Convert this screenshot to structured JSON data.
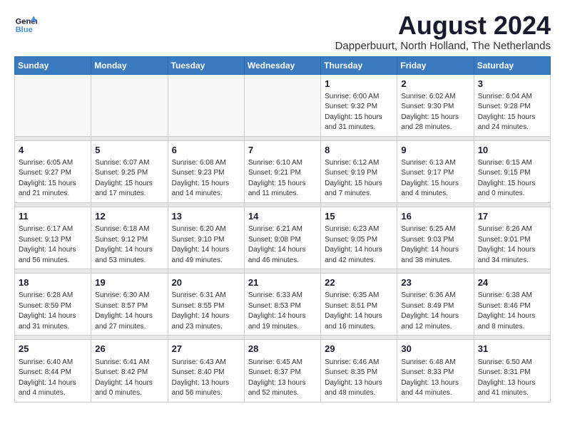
{
  "logo": {
    "line1": "General",
    "line2": "Blue"
  },
  "title": "August 2024",
  "subtitle": "Dapperbuurt, North Holland, The Netherlands",
  "days_of_week": [
    "Sunday",
    "Monday",
    "Tuesday",
    "Wednesday",
    "Thursday",
    "Friday",
    "Saturday"
  ],
  "weeks": [
    [
      {
        "day": "",
        "info": ""
      },
      {
        "day": "",
        "info": ""
      },
      {
        "day": "",
        "info": ""
      },
      {
        "day": "",
        "info": ""
      },
      {
        "day": "1",
        "info": "Sunrise: 6:00 AM\nSunset: 9:32 PM\nDaylight: 15 hours\nand 31 minutes."
      },
      {
        "day": "2",
        "info": "Sunrise: 6:02 AM\nSunset: 9:30 PM\nDaylight: 15 hours\nand 28 minutes."
      },
      {
        "day": "3",
        "info": "Sunrise: 6:04 AM\nSunset: 9:28 PM\nDaylight: 15 hours\nand 24 minutes."
      }
    ],
    [
      {
        "day": "4",
        "info": "Sunrise: 6:05 AM\nSunset: 9:27 PM\nDaylight: 15 hours\nand 21 minutes."
      },
      {
        "day": "5",
        "info": "Sunrise: 6:07 AM\nSunset: 9:25 PM\nDaylight: 15 hours\nand 17 minutes."
      },
      {
        "day": "6",
        "info": "Sunrise: 6:08 AM\nSunset: 9:23 PM\nDaylight: 15 hours\nand 14 minutes."
      },
      {
        "day": "7",
        "info": "Sunrise: 6:10 AM\nSunset: 9:21 PM\nDaylight: 15 hours\nand 11 minutes."
      },
      {
        "day": "8",
        "info": "Sunrise: 6:12 AM\nSunset: 9:19 PM\nDaylight: 15 hours\nand 7 minutes."
      },
      {
        "day": "9",
        "info": "Sunrise: 6:13 AM\nSunset: 9:17 PM\nDaylight: 15 hours\nand 4 minutes."
      },
      {
        "day": "10",
        "info": "Sunrise: 6:15 AM\nSunset: 9:15 PM\nDaylight: 15 hours\nand 0 minutes."
      }
    ],
    [
      {
        "day": "11",
        "info": "Sunrise: 6:17 AM\nSunset: 9:13 PM\nDaylight: 14 hours\nand 56 minutes."
      },
      {
        "day": "12",
        "info": "Sunrise: 6:18 AM\nSunset: 9:12 PM\nDaylight: 14 hours\nand 53 minutes."
      },
      {
        "day": "13",
        "info": "Sunrise: 6:20 AM\nSunset: 9:10 PM\nDaylight: 14 hours\nand 49 minutes."
      },
      {
        "day": "14",
        "info": "Sunrise: 6:21 AM\nSunset: 9:08 PM\nDaylight: 14 hours\nand 46 minutes."
      },
      {
        "day": "15",
        "info": "Sunrise: 6:23 AM\nSunset: 9:05 PM\nDaylight: 14 hours\nand 42 minutes."
      },
      {
        "day": "16",
        "info": "Sunrise: 6:25 AM\nSunset: 9:03 PM\nDaylight: 14 hours\nand 38 minutes."
      },
      {
        "day": "17",
        "info": "Sunrise: 6:26 AM\nSunset: 9:01 PM\nDaylight: 14 hours\nand 34 minutes."
      }
    ],
    [
      {
        "day": "18",
        "info": "Sunrise: 6:28 AM\nSunset: 8:59 PM\nDaylight: 14 hours\nand 31 minutes."
      },
      {
        "day": "19",
        "info": "Sunrise: 6:30 AM\nSunset: 8:57 PM\nDaylight: 14 hours\nand 27 minutes."
      },
      {
        "day": "20",
        "info": "Sunrise: 6:31 AM\nSunset: 8:55 PM\nDaylight: 14 hours\nand 23 minutes."
      },
      {
        "day": "21",
        "info": "Sunrise: 6:33 AM\nSunset: 8:53 PM\nDaylight: 14 hours\nand 19 minutes."
      },
      {
        "day": "22",
        "info": "Sunrise: 6:35 AM\nSunset: 8:51 PM\nDaylight: 14 hours\nand 16 minutes."
      },
      {
        "day": "23",
        "info": "Sunrise: 6:36 AM\nSunset: 8:49 PM\nDaylight: 14 hours\nand 12 minutes."
      },
      {
        "day": "24",
        "info": "Sunrise: 6:38 AM\nSunset: 8:46 PM\nDaylight: 14 hours\nand 8 minutes."
      }
    ],
    [
      {
        "day": "25",
        "info": "Sunrise: 6:40 AM\nSunset: 8:44 PM\nDaylight: 14 hours\nand 4 minutes."
      },
      {
        "day": "26",
        "info": "Sunrise: 6:41 AM\nSunset: 8:42 PM\nDaylight: 14 hours\nand 0 minutes."
      },
      {
        "day": "27",
        "info": "Sunrise: 6:43 AM\nSunset: 8:40 PM\nDaylight: 13 hours\nand 56 minutes."
      },
      {
        "day": "28",
        "info": "Sunrise: 6:45 AM\nSunset: 8:37 PM\nDaylight: 13 hours\nand 52 minutes."
      },
      {
        "day": "29",
        "info": "Sunrise: 6:46 AM\nSunset: 8:35 PM\nDaylight: 13 hours\nand 48 minutes."
      },
      {
        "day": "30",
        "info": "Sunrise: 6:48 AM\nSunset: 8:33 PM\nDaylight: 13 hours\nand 44 minutes."
      },
      {
        "day": "31",
        "info": "Sunrise: 6:50 AM\nSunset: 8:31 PM\nDaylight: 13 hours\nand 41 minutes."
      }
    ]
  ]
}
